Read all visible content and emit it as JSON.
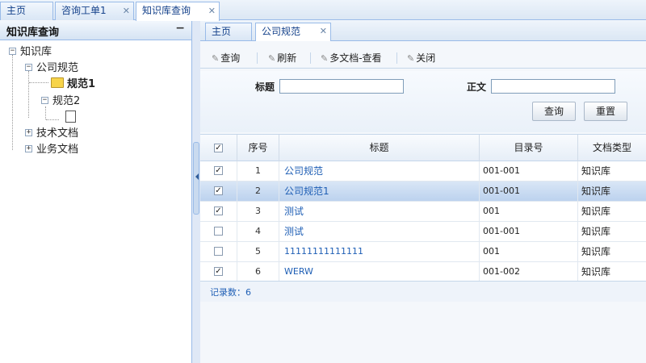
{
  "top_tabs": [
    {
      "label": "主页",
      "closable": false
    },
    {
      "label": "咨询工单1",
      "closable": true
    },
    {
      "label": "知识库查询",
      "closable": true
    }
  ],
  "left_panel": {
    "title": "知识库查询",
    "collapse": "−",
    "tree": {
      "root": "知识库",
      "company_spec": "公司规范",
      "spec1": "规范1",
      "spec2": "规范2",
      "tech_docs": "技术文档",
      "biz_docs": "业务文档"
    }
  },
  "inner_tabs": [
    {
      "label": "主页",
      "closable": false
    },
    {
      "label": "公司规范",
      "closable": true
    }
  ],
  "toolbar": {
    "query": "查询",
    "refresh": "刷新",
    "multi_view": "多文档-查看",
    "close": "关闭"
  },
  "search": {
    "title_label": "标题",
    "title_value": "",
    "body_label": "正文",
    "body_value": "",
    "query_button": "查询",
    "reset_button": "重置"
  },
  "grid": {
    "columns": [
      "序号",
      "标题",
      "目录号",
      "文档类型"
    ],
    "rows": [
      {
        "no": "1",
        "title": "公司规范",
        "dir": "001-001",
        "type": "知识库",
        "checked": true,
        "selected": false
      },
      {
        "no": "2",
        "title": "公司规范1",
        "dir": "001-001",
        "type": "知识库",
        "checked": true,
        "selected": true
      },
      {
        "no": "3",
        "title": "测试",
        "dir": "001",
        "type": "知识库",
        "checked": true,
        "selected": false
      },
      {
        "no": "4",
        "title": "测试",
        "dir": "001-001",
        "type": "知识库",
        "checked": false,
        "selected": false
      },
      {
        "no": "5",
        "title": "11111111111111",
        "dir": "001",
        "type": "知识库",
        "checked": false,
        "selected": false
      },
      {
        "no": "6",
        "title": "WERW",
        "dir": "001-002",
        "type": "知识库",
        "checked": true,
        "selected": false
      }
    ],
    "record_count": "记录数：6"
  }
}
